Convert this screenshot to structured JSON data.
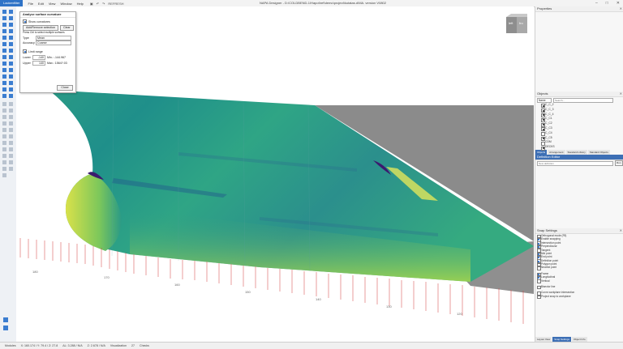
{
  "menubar": {
    "active_tab": "Lackenfilter",
    "menus": [
      "File",
      "Edit",
      "View",
      "Window",
      "Help"
    ],
    "quick_access": [
      "REFRESH"
    ],
    "title": "NAPA Designer - D:\\COLDBEND-1\\Hapot\\ref\\demo\\project\\kutatas.d\\MA. version V0802"
  },
  "dialog": {
    "title": "Analyse surface curvature",
    "show_curvatures_label": "Show curvatures",
    "add_remove_label": "Add/Remove selection",
    "clear_label": "Clear",
    "hint": "Press Ctrl to select multiple surfaces",
    "type_label": "Type",
    "type_value": "Mean",
    "accuracy_label": "Accuracy",
    "accuracy_value": "Coarse",
    "limit_range_label": "Limit range",
    "lower_label": "Lower",
    "lower_value": "-140",
    "lower_min": "Min.: -144.967",
    "upper_label": "Upper",
    "upper_value": "140",
    "upper_max": "Max.: 1564?.03",
    "close_label": "Close"
  },
  "navcube": {
    "left": "left",
    "right": "fro"
  },
  "properties": {
    "title": "Properties"
  },
  "objects": {
    "title": "Objects",
    "filter_label": "Name",
    "search_placeholder": "Search...",
    "items": [
      {
        "label": "C_C_2",
        "checked": true
      },
      {
        "label": "C_C_3",
        "checked": true
      },
      {
        "label": "C_C_4",
        "checked": true
      },
      {
        "label": "C_C1",
        "checked": true
      },
      {
        "label": "C_C2",
        "checked": true
      },
      {
        "label": "C_C3",
        "checked": true
      },
      {
        "label": "C_C4",
        "checked": false
      },
      {
        "label": "C_C5",
        "checked": true
      },
      {
        "label": "CDM",
        "checked": false
      },
      {
        "label": "DECKS",
        "checked": true
      }
    ],
    "tabs": [
      "Objects",
      "Arrangement",
      "Standard Library",
      "Standard Objects"
    ]
  },
  "definition": {
    "title": "Definition Editor",
    "placeholder": "New definition",
    "button": "Run"
  },
  "snap": {
    "title": "Snap Settings",
    "items": [
      {
        "label": "Orthogonal mode (F8)",
        "checked": false
      },
      {
        "label": "Enable snapping",
        "checked": true
      },
      {
        "label": "Intersection point",
        "checked": true
      },
      {
        "label": "Perpendicular",
        "checked": true
      },
      {
        "label": "Tangent",
        "checked": false
      },
      {
        "label": "Mid point",
        "checked": true
      },
      {
        "label": "End point",
        "checked": true
      },
      {
        "label": "Definition point",
        "checked": true
      },
      {
        "label": "Polygon point",
        "checked": false
      },
      {
        "label": "Nearest point",
        "checked": false
      },
      {
        "label": "",
        "checked": false
      },
      {
        "label": "Frame",
        "checked": true
      },
      {
        "label": "Longitudinal",
        "checked": true
      },
      {
        "label": "Vertical",
        "checked": false
      },
      {
        "label": "",
        "checked": false
      },
      {
        "label": "Bisector line",
        "checked": false
      },
      {
        "label": "",
        "checked": false
      },
      {
        "label": "Curve-workplane intersection",
        "checked": false
      },
      {
        "label": "Project snap to workplane",
        "checked": false
      }
    ],
    "bottom_tabs": [
      "Layout View",
      "Snap Settings",
      "Object Info"
    ]
  },
  "axis": {
    "ticks": [
      "180",
      "170",
      "160",
      "150",
      "140",
      "130",
      "120"
    ]
  },
  "status": {
    "modules": "Modules",
    "coords1": "X: 160.174 / Y: 79.4 / Z: 27.8",
    "coords2": "ΔL: 3.288 / N/A",
    "coords3": "Z: 2.678 / N/A",
    "visualization": "Visualization",
    "value": "27",
    "checks": "Checks"
  },
  "colors": {
    "accent": "#2f73c7",
    "hull_gray": "#8b8b8b",
    "curvature_low": "#3b1a6e",
    "curvature_mid": "#1f8f8a",
    "curvature_high": "#d9e14a"
  }
}
